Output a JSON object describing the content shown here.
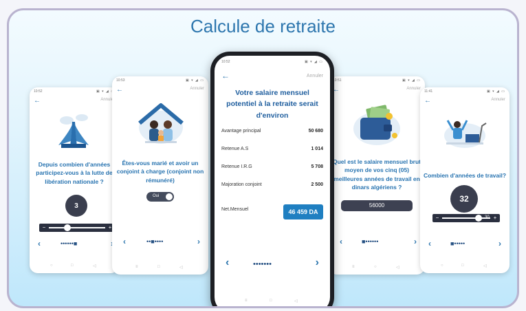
{
  "title": "Calcule de retraite",
  "status": {
    "time_a": "10:52",
    "time_b": "10:53",
    "time_c": "10:51",
    "time_d": "11:41"
  },
  "labels": {
    "cancel": "Annuler"
  },
  "screen1": {
    "question": "Depuis combien d'années participez-vous à la lutte de libération nationale ?",
    "value": "3",
    "dots": "••••••■"
  },
  "screen2": {
    "question": "Êtes-vous marié et avoir un conjoint à charge (conjoint non rémunéré)",
    "toggle_label": "Oui",
    "dots": "••■••••"
  },
  "center": {
    "heading": "Votre salaire mensuel potentiel à la retraite serait d'environ",
    "rows": [
      {
        "label": "Avantage principal",
        "value": "50 680"
      },
      {
        "label": "Retenue A.S",
        "value": "1 014"
      },
      {
        "label": "Retenue I.R.G",
        "value": "5 708"
      },
      {
        "label": "Majoration conjoint",
        "value": "2 500"
      }
    ],
    "net_label": "Net.Mensuel",
    "net_value": "46 459 DA",
    "dots": "•••••••"
  },
  "screen4": {
    "question": "Quel est le salaire mensuel brut moyen de vos cinq (05) meilleures années de travail en dinars algériens ?",
    "value": "56000",
    "dots": "■••••••"
  },
  "screen5": {
    "question": "Combien d'années de travail?",
    "value": "32",
    "slider_value": "30",
    "dots": "■•••••"
  }
}
